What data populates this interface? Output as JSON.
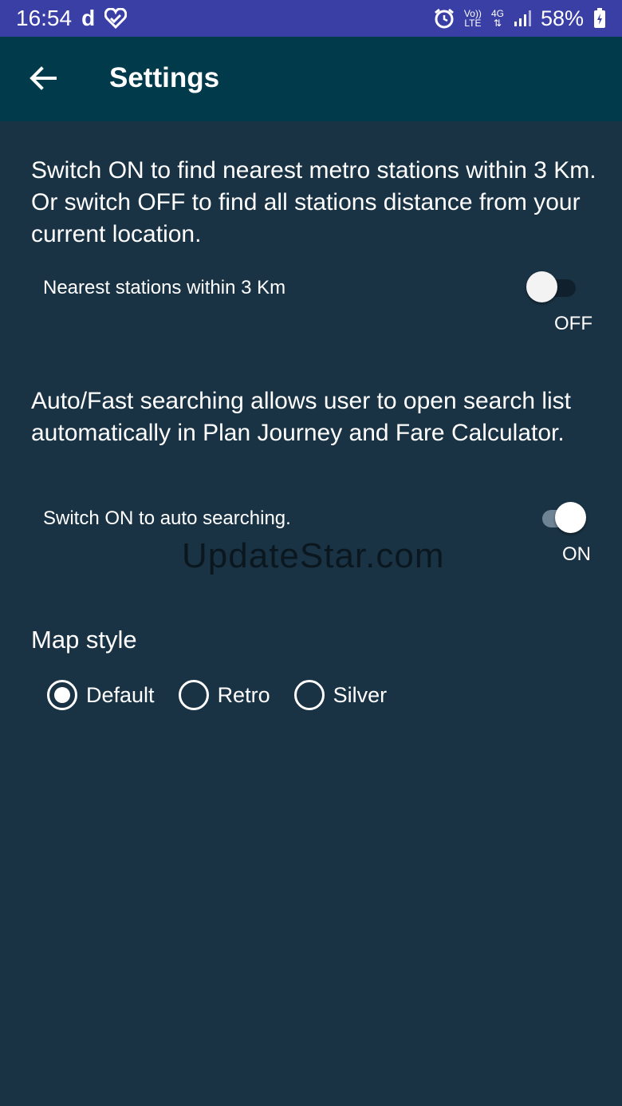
{
  "status_bar": {
    "time": "16:54",
    "carrier_icon_text": "d",
    "volte_top": "Vo))",
    "volte_bottom": "LTE",
    "network_type": "4G",
    "battery_percent": "58%",
    "icons": [
      "heart-icon",
      "alarm-icon",
      "signal-icon",
      "battery-icon"
    ]
  },
  "app_bar": {
    "title": "Settings",
    "back_icon": "arrow-left-icon",
    "background": "#013a4b"
  },
  "nearest": {
    "description": "Switch ON to find nearest metro stations within 3 Km. Or switch OFF to find all stations distance from your current location.",
    "label": "Nearest stations within 3 Km",
    "enabled": false,
    "state_text": "OFF"
  },
  "auto_search": {
    "description": "Auto/Fast searching allows user to open search list automatically in Plan Journey and Fare Calculator.",
    "label": "Switch ON to auto searching.",
    "enabled": true,
    "state_text": "ON"
  },
  "watermark": "UpdateStar.com",
  "map_style": {
    "title": "Map style",
    "options": [
      {
        "label": "Default",
        "selected": true
      },
      {
        "label": "Retro",
        "selected": false
      },
      {
        "label": "Silver",
        "selected": false
      }
    ]
  },
  "colors": {
    "background": "#193345",
    "status_bar": "#3a3fa6"
  }
}
